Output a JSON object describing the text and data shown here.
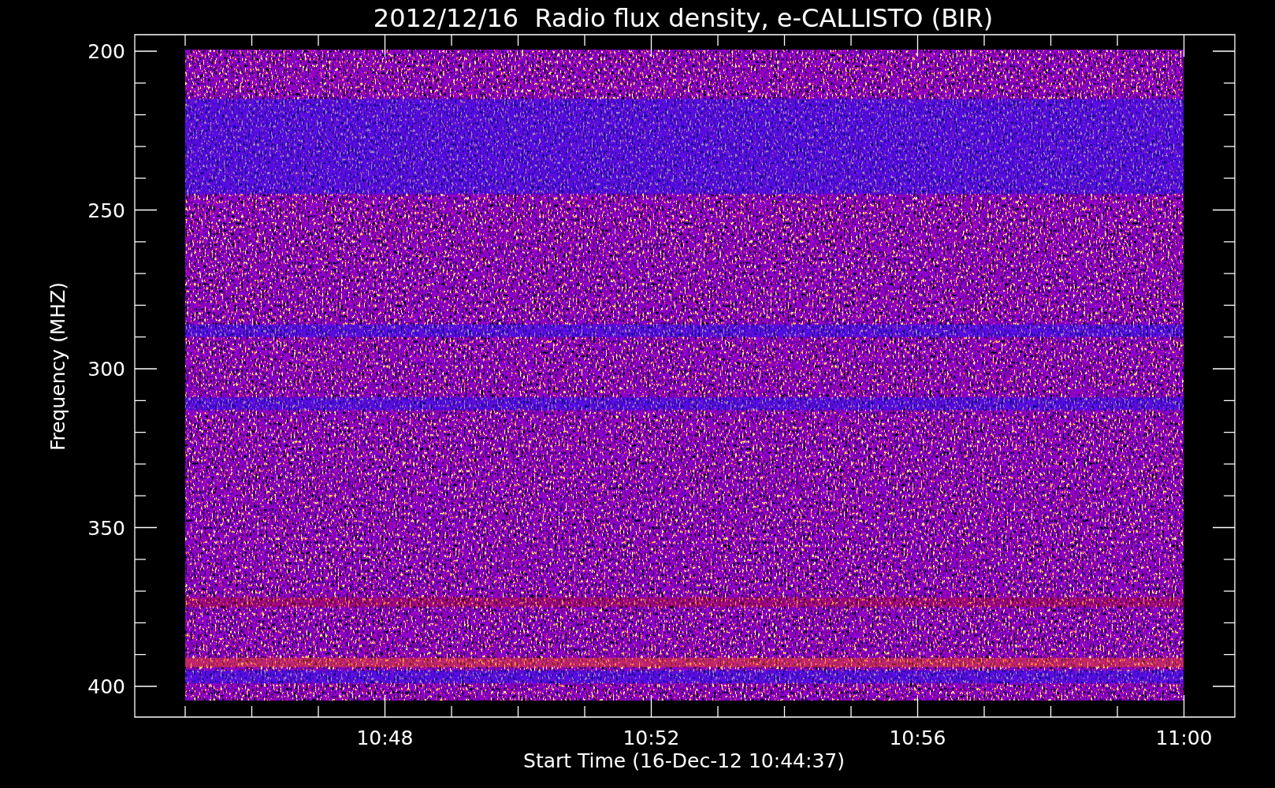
{
  "title": "2012/12/16  Radio flux density, e-CALLISTO (BIR)",
  "y_axis": {
    "label": "Frequency (MHZ)",
    "ticks": [
      "200",
      "250",
      "300",
      "350",
      "400"
    ]
  },
  "x_axis": {
    "label": "Start Time (16-Dec-12 10:44:37)",
    "ticks": [
      "10:48",
      "10:52",
      "10:56",
      "11:00"
    ]
  }
}
